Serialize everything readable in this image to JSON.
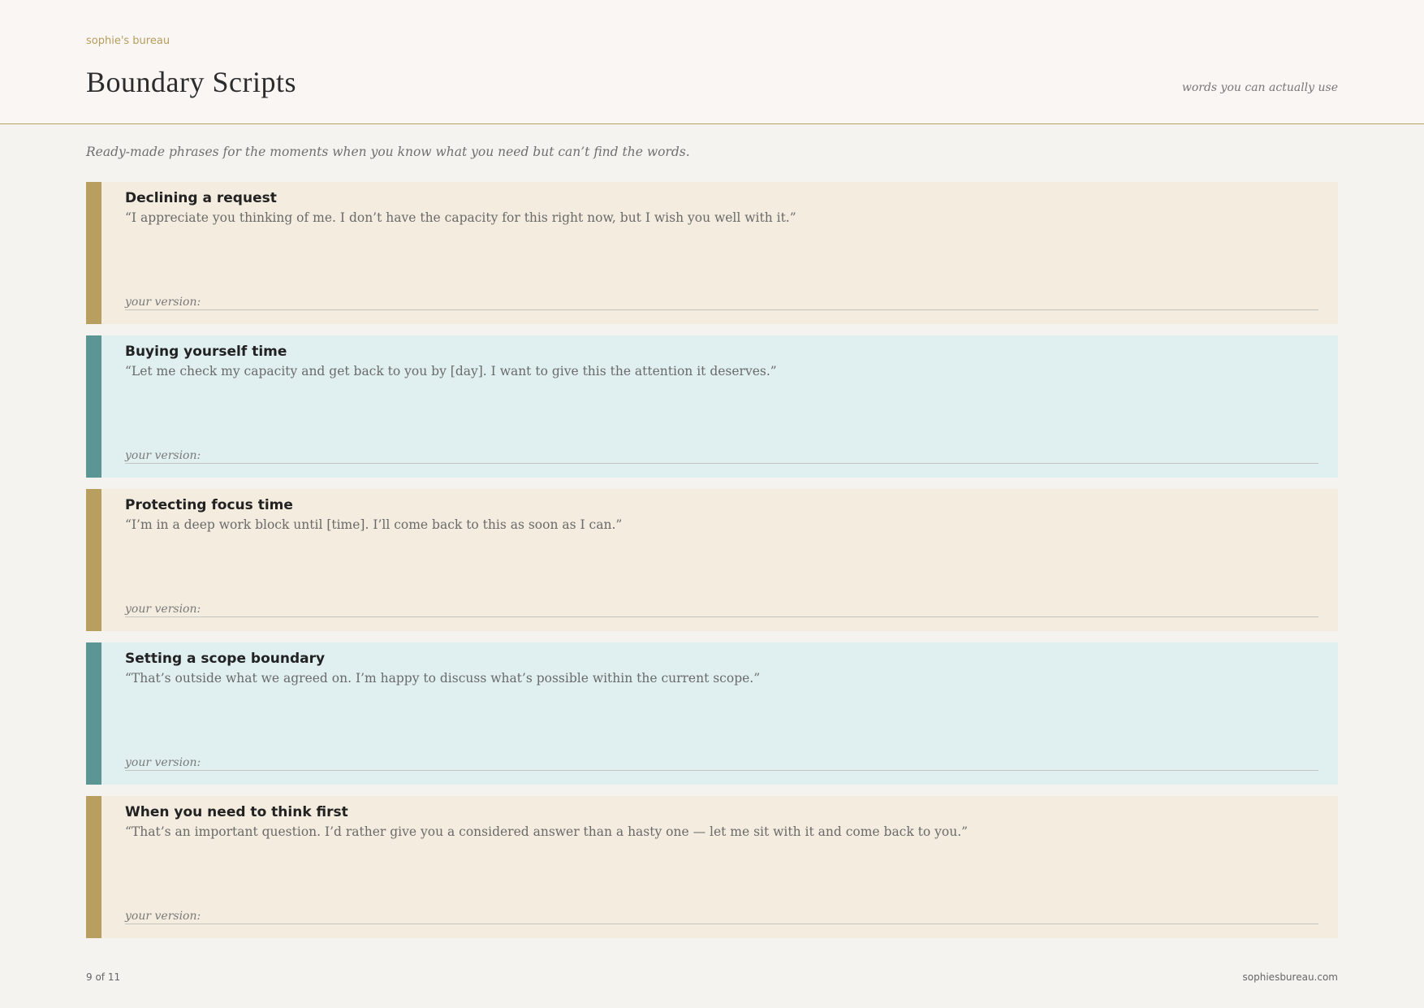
{
  "header": {
    "brand": "sophie's bureau",
    "title": "Boundary Scripts",
    "tagline": "words you can actually use"
  },
  "intro": "Ready-made phrases for the moments when you know what you need but can’t find the words.",
  "colors": {
    "warm_accent": "#b89e5f",
    "cool_accent": "#5b9594",
    "warm_background": "#f3ecdf",
    "cool_background": "#e0eff0",
    "header_rule": "#b9a161"
  },
  "scripts": [
    {
      "title": "Declining a request",
      "quote": "“I appreciate you thinking of me. I don’t have the capacity for this right now, but I wish you well with it.”",
      "version_label": "your version:",
      "version_value": "",
      "theme": "warm"
    },
    {
      "title": "Buying yourself time",
      "quote": "“Let me check my capacity and get back to you by [day]. I want to give this the attention it deserves.”",
      "version_label": "your version:",
      "version_value": "",
      "theme": "cool"
    },
    {
      "title": "Protecting focus time",
      "quote": "“I’m in a deep work block until [time]. I’ll come back to this as soon as I can.”",
      "version_label": "your version:",
      "version_value": "",
      "theme": "warm"
    },
    {
      "title": "Setting a scope boundary",
      "quote": "“That’s outside what we agreed on. I’m happy to discuss what’s possible within the current scope.”",
      "version_label": "your version:",
      "version_value": "",
      "theme": "cool"
    },
    {
      "title": "When you need to think first",
      "quote": "“That’s an important question. I’d rather give you a considered answer than a hasty one — let me sit with it and come back to you.”",
      "version_label": "your version:",
      "version_value": "",
      "theme": "warm"
    }
  ],
  "footer": {
    "page": "9 of 11",
    "site": "sophiesbureau.com"
  }
}
